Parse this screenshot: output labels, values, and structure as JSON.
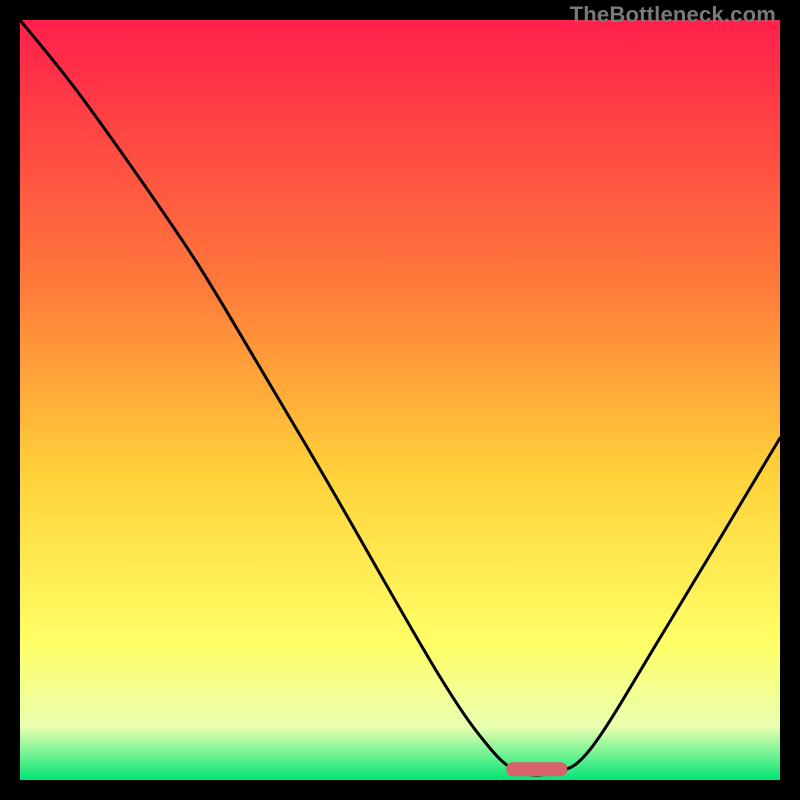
{
  "watermark": "TheBottleneck.com",
  "colors": {
    "gradient_top": "#ff1f4b",
    "gradient_mid1": "#ff7a3a",
    "gradient_mid2": "#ffd23a",
    "gradient_mid3": "#ffff66",
    "gradient_mid4": "#eaffb0",
    "gradient_bottom": "#00e676",
    "curve": "#000000",
    "marker": "#d9636a",
    "frame": "#000000"
  },
  "chart_data": {
    "type": "line",
    "title": "",
    "xlabel": "",
    "ylabel": "",
    "xlim": [
      0,
      100
    ],
    "ylim": [
      0,
      100
    ],
    "series": [
      {
        "name": "bottleneck-curve",
        "x": [
          0,
          8,
          20,
          27,
          40,
          55,
          62,
          66,
          70,
          75,
          85,
          100
        ],
        "values": [
          100,
          90,
          73,
          62,
          40,
          14,
          4,
          1,
          1,
          4,
          20,
          45
        ]
      }
    ],
    "annotations": [
      {
        "name": "optimal-marker",
        "x_range": [
          64,
          72
        ],
        "y": 0.5
      }
    ]
  }
}
